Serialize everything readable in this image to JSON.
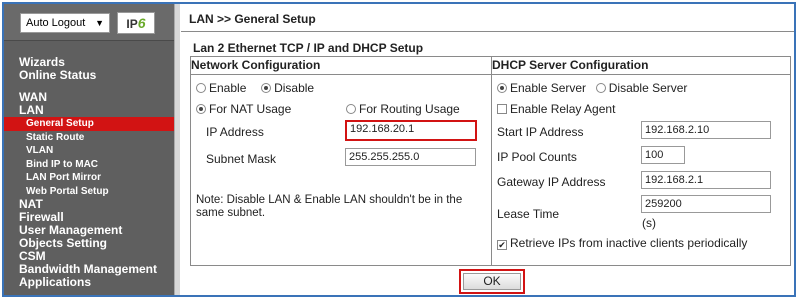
{
  "sidebar": {
    "auto_logout": "Auto Logout",
    "ipv6_logo_text": "IPv6",
    "menu": [
      {
        "label": "Wizards",
        "level": 1
      },
      {
        "label": "Online Status",
        "level": 1
      },
      {
        "gap": true
      },
      {
        "label": "WAN",
        "level": 1
      },
      {
        "label": "LAN",
        "level": 1
      },
      {
        "label": "General Setup",
        "level": 2,
        "active": true
      },
      {
        "label": "Static Route",
        "level": 2
      },
      {
        "label": "VLAN",
        "level": 2
      },
      {
        "label": "Bind IP to MAC",
        "level": 2
      },
      {
        "label": "LAN Port Mirror",
        "level": 2
      },
      {
        "label": "Web Portal Setup",
        "level": 2
      },
      {
        "label": "NAT",
        "level": 1
      },
      {
        "label": "Firewall",
        "level": 1
      },
      {
        "label": "User Management",
        "level": 1
      },
      {
        "label": "Objects Setting",
        "level": 1
      },
      {
        "label": "CSM",
        "level": 1
      },
      {
        "label": "Bandwidth Management",
        "level": 1
      },
      {
        "label": "Applications",
        "level": 1
      }
    ]
  },
  "breadcrumb": "LAN >> General Setup",
  "section_title": "Lan 2 Ethernet TCP / IP and DHCP Setup",
  "network": {
    "heading": "Network Configuration",
    "enable_label": "Enable",
    "disable_label": "Disable",
    "enable_selected": false,
    "nat_label": "For NAT Usage",
    "routing_label": "For Routing Usage",
    "nat_selected": true,
    "ip_label": "IP Address",
    "ip_value": "192.168.20.1",
    "mask_label": "Subnet Mask",
    "mask_value": "255.255.255.0",
    "note": "Note: Disable LAN & Enable LAN shouldn't be in the same subnet."
  },
  "dhcp": {
    "heading": "DHCP Server Configuration",
    "enable_server_label": "Enable Server",
    "disable_server_label": "Disable Server",
    "relay_label": "Enable Relay Agent",
    "start_ip_label": "Start IP Address",
    "start_ip_value": "192.168.2.10",
    "pool_label": "IP Pool Counts",
    "pool_value": "100",
    "gateway_label": "Gateway IP Address",
    "gateway_value": "192.168.2.1",
    "lease_label": "Lease Time",
    "lease_value": "259200",
    "lease_unit": "(s)",
    "retrieve_label": "Retrieve IPs from inactive clients periodically"
  },
  "ok_label": "OK",
  "colors": {
    "accent": "#d21313",
    "frame": "#3a73b8",
    "sidebar": "#5f5f5f"
  }
}
